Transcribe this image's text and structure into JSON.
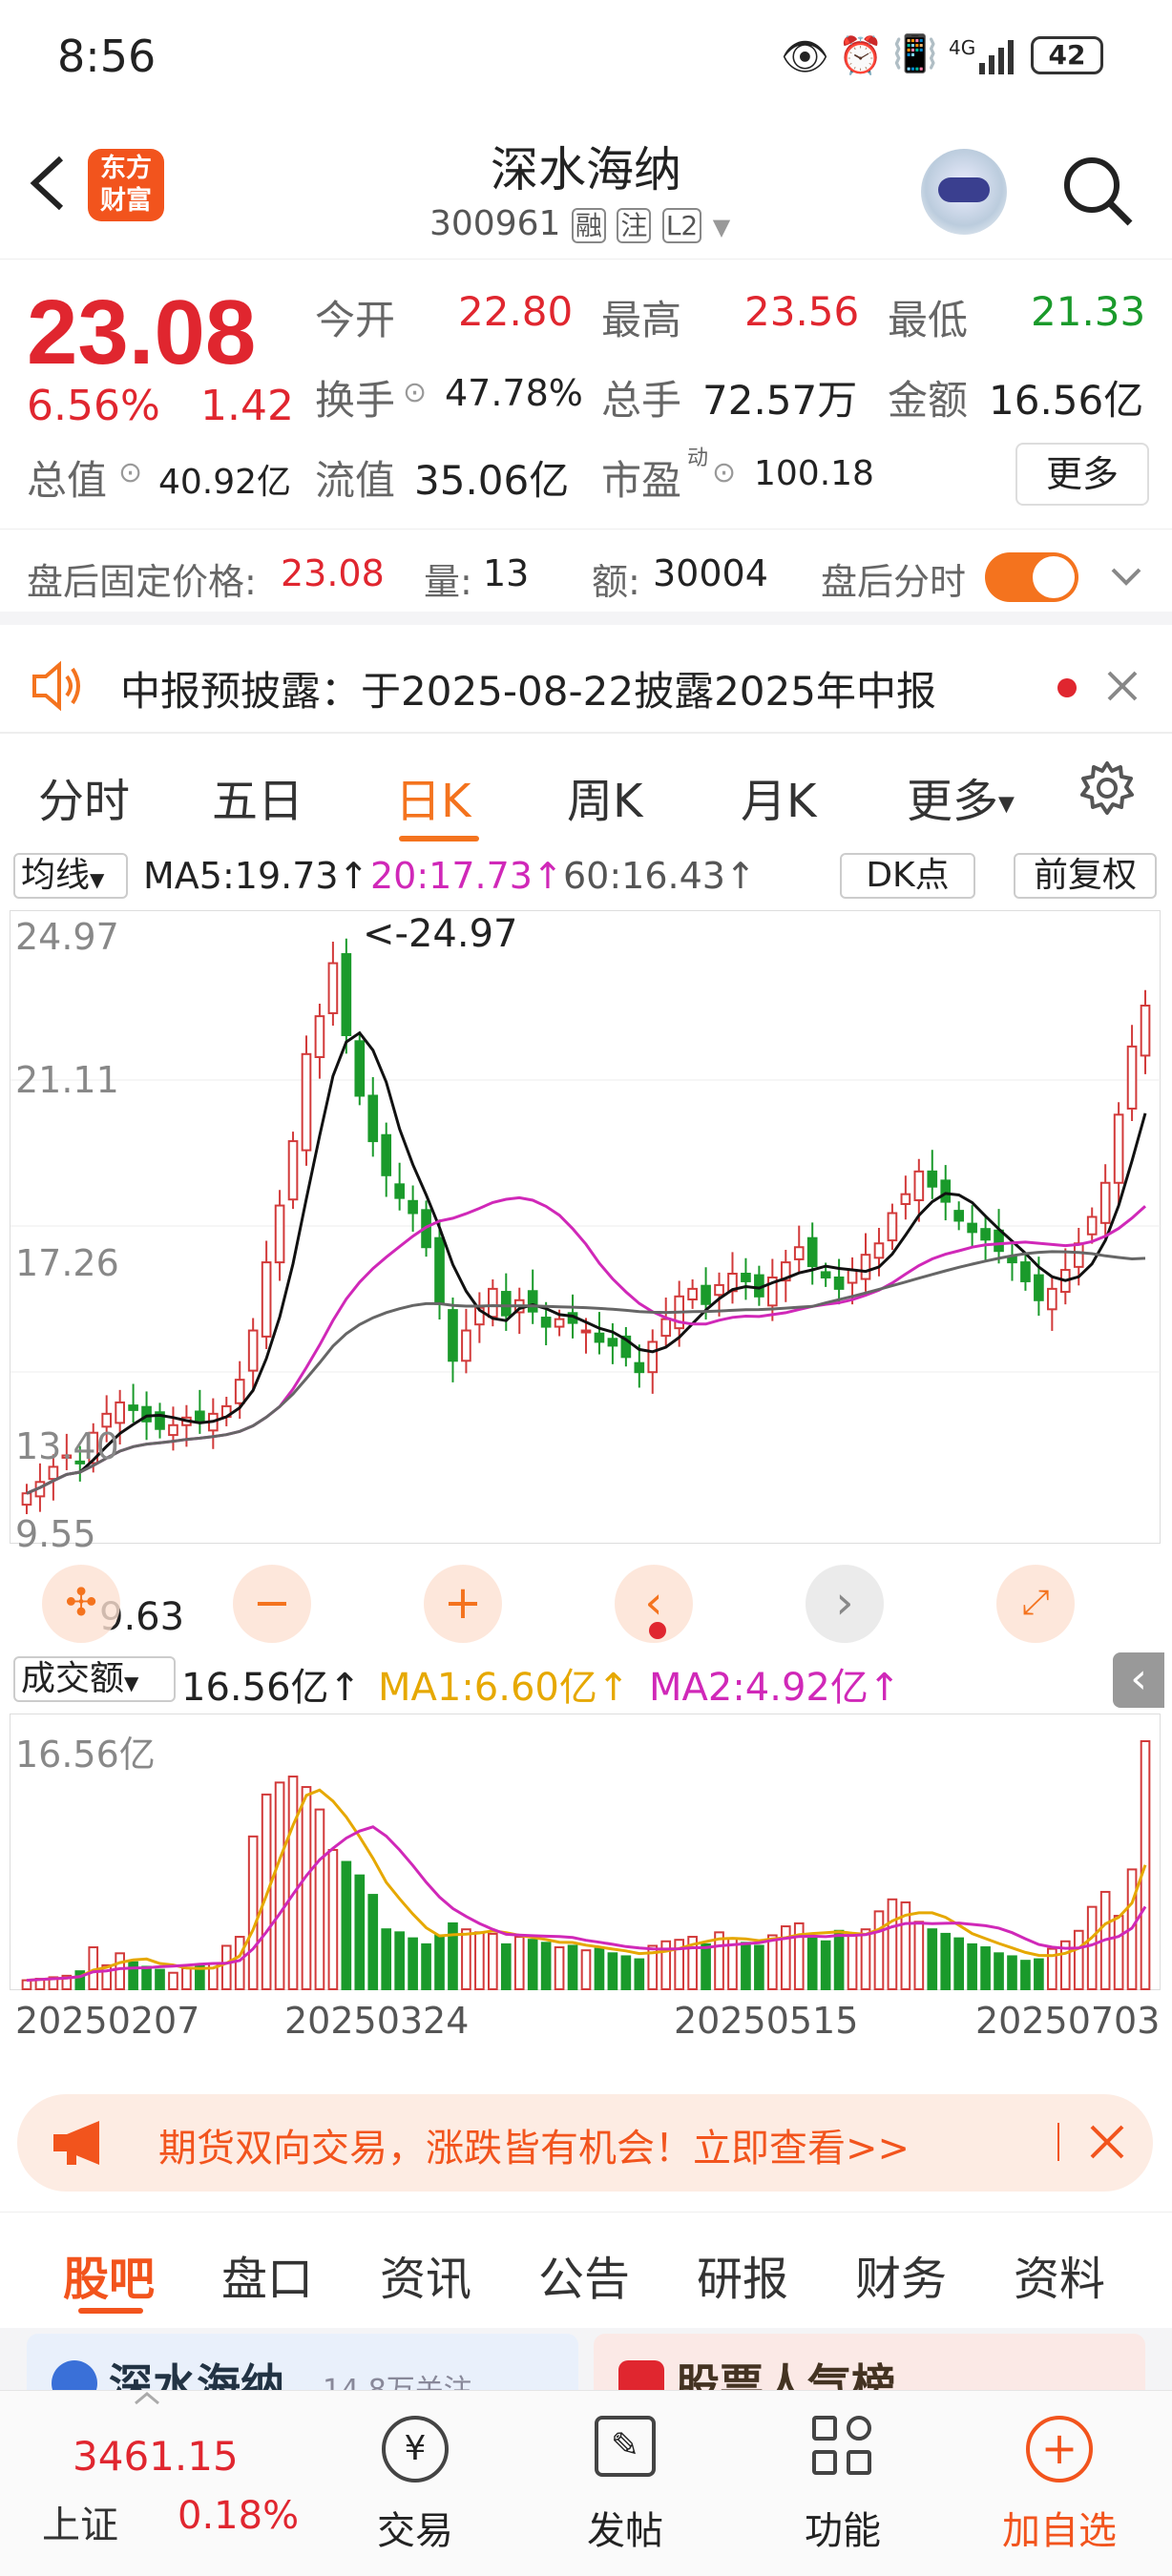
{
  "status": {
    "time": "8:56",
    "battery": "42",
    "network": "4G"
  },
  "nav": {
    "title": "深水海纳",
    "code": "300961",
    "tag1": "融",
    "tag2": "注",
    "tag3": "L2",
    "logo_line1": "东方",
    "logo_line2": "财富"
  },
  "quote": {
    "price": "23.08",
    "pct": "6.56%",
    "chg": "1.42",
    "open_label": "今开",
    "open": "22.80",
    "high_label": "最高",
    "high": "23.56",
    "low_label": "最低",
    "low": "21.33",
    "turnover_label": "换手",
    "turnover": "47.78%",
    "volume_label": "总手",
    "volume": "72.57万",
    "amount_label": "金额",
    "amount": "16.56亿",
    "mktcap_label": "总值",
    "mktcap": "40.92亿",
    "float_label": "流值",
    "float": "35.06亿",
    "pe_label": "市盈",
    "pe_sup": "动",
    "pe": "100.18",
    "more": "更多"
  },
  "after": {
    "price_label": "盘后固定价格:",
    "price": "23.08",
    "vol_label": "量:",
    "vol": "13",
    "amt_label": "额:",
    "amt": "30004",
    "toggle_label": "盘后分时"
  },
  "notice": {
    "text": "中报预披露：于2025-08-22披露2025年中报"
  },
  "ktabs": [
    "分时",
    "五日",
    "日K",
    "周K",
    "月K",
    "更多"
  ],
  "ma_bar": {
    "select": "均线",
    "ma5": "MA5:19.73↑",
    "ma20": "20:17.73↑",
    "ma60": "60:16.43↑",
    "dk": "DK点",
    "adj": "前复权"
  },
  "chart_data": {
    "type": "candlestick",
    "y_ticks": [
      "24.97",
      "21.11",
      "17.26",
      "13.40",
      "9.55"
    ],
    "max_label": "<-24.97",
    "min_label": "9.63",
    "vol_bar": {
      "select": "成交额",
      "val": "16.56亿↑",
      "ma1": "MA1:6.60亿↑",
      "ma2": "MA2:4.92亿↑",
      "top": "16.56亿"
    },
    "x_labels": [
      "20250207",
      "20250324",
      "20250515",
      "20250703"
    ],
    "closes": [
      10.2,
      10.5,
      10.9,
      11.2,
      11.0,
      11.8,
      12.3,
      12.6,
      12.4,
      12.1,
      11.9,
      12.0,
      12.2,
      12.1,
      12.3,
      12.5,
      13.2,
      14.5,
      16.3,
      17.8,
      19.5,
      21.8,
      22.8,
      24.2,
      22.3,
      20.7,
      19.5,
      18.6,
      18.0,
      17.6,
      16.7,
      15.2,
      13.7,
      14.5,
      15.1,
      15.6,
      14.9,
      15.3,
      15.0,
      14.6,
      14.8,
      14.7,
      14.5,
      14.2,
      14.1,
      13.8,
      13.4,
      14.2,
      14.8,
      15.4,
      15.6,
      15.2,
      15.7,
      16.0,
      15.8,
      15.4,
      15.9,
      16.3,
      16.7,
      16.2,
      15.9,
      15.6,
      16.1,
      16.5,
      16.8,
      17.6,
      18.1,
      18.7,
      18.3,
      17.9,
      17.4,
      17.1,
      16.9,
      16.6,
      16.3,
      15.8,
      15.3,
      15.6,
      16.1,
      16.8,
      17.5,
      18.4,
      20.2,
      22.0,
      23.08
    ],
    "volumes": [
      0.6,
      0.7,
      0.8,
      0.9,
      1.2,
      2.8,
      1.6,
      2.4,
      1.8,
      1.5,
      1.3,
      1.1,
      1.4,
      1.6,
      1.7,
      2.9,
      3.5,
      10.2,
      13.0,
      13.8,
      14.2,
      13.5,
      12.0,
      9.3,
      8.5,
      7.6,
      6.3,
      4.0,
      3.8,
      3.4,
      3.0,
      3.6,
      4.4,
      4.0,
      3.8,
      3.7,
      3.0,
      3.5,
      3.3,
      3.1,
      2.8,
      2.9,
      2.6,
      2.7,
      2.4,
      2.2,
      2.0,
      2.9,
      3.2,
      3.3,
      3.5,
      3.0,
      3.8,
      3.4,
      3.1,
      2.9,
      3.6,
      4.2,
      4.4,
      3.5,
      3.2,
      3.9,
      3.7,
      4.0,
      5.2,
      6.0,
      5.8,
      4.5,
      4.0,
      3.7,
      3.4,
      3.0,
      2.8,
      2.4,
      2.2,
      1.9,
      2.0,
      2.7,
      3.2,
      3.9,
      5.5,
      6.5,
      4.9,
      8.0,
      16.56
    ]
  },
  "ad": {
    "text": "期货双向交易，涨跌皆有机会！立即查看>>"
  },
  "btabs": [
    "股吧",
    "盘口",
    "资讯",
    "公告",
    "研报",
    "财务",
    "资料"
  ],
  "cards": {
    "c1": "深水海纳",
    "c1sub": "14.8万关注",
    "c2": "股票人气榜"
  },
  "bottom": {
    "index": "3461.15",
    "index_name": "上证",
    "index_pct": "0.18%",
    "trade": "交易",
    "post": "发帖",
    "func": "功能",
    "add": "加自选"
  }
}
